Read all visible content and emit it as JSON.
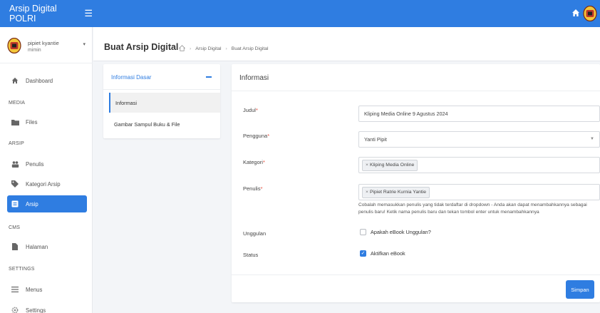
{
  "app": {
    "brand": "Arsip Digital POLRI"
  },
  "user": {
    "name": "pipiet kyantie",
    "role": "mimin"
  },
  "sidebar": {
    "items": [
      {
        "label": "Dashboard"
      },
      {
        "section": "MEDIA"
      },
      {
        "label": "Files"
      },
      {
        "section": "ARSIP"
      },
      {
        "label": "Penulis"
      },
      {
        "label": "Kategori Arsip"
      },
      {
        "label": "Arsip"
      },
      {
        "section": "CMS"
      },
      {
        "label": "Halaman"
      },
      {
        "section": "SETTINGS"
      },
      {
        "label": "Menus"
      },
      {
        "label": "Settings"
      }
    ]
  },
  "header": {
    "title": "Buat Arsip Digital",
    "breadcrumb": [
      "Arsip Digital",
      "Buat Arsip Digital"
    ]
  },
  "left_panel": {
    "title": "Informasi Dasar",
    "items": [
      {
        "label": "Informasi"
      },
      {
        "label": "Gambar Sampul Buku & File"
      }
    ]
  },
  "form": {
    "title": "Informasi",
    "judul": {
      "label": "Judul",
      "value": "Kliping Media Online 9 Agustus 2024"
    },
    "pengguna": {
      "label": "Pengguna",
      "value": "Yanti Pipit"
    },
    "kategori": {
      "label": "Kategori",
      "tag": "Kliping Media Online"
    },
    "penulis": {
      "label": "Penulis",
      "tag": "Pipiet Ratrie Kurnia Yantie"
    },
    "help": "Cobalah memasukkan penulis yang tidak terdaftar di dropdown - Anda akan dapat menambahkannya sebagai penulis baru! Ketik nama penulis baru dan tekan tombol enter untuk menambahkannya",
    "unggulan": {
      "label": "Unggulan",
      "checkbox": "Apakah eBook Unggulan?",
      "checked": false
    },
    "status": {
      "label": "Status",
      "checkbox": "Aktifkan eBook",
      "checked": true
    },
    "save": "Simpan"
  }
}
